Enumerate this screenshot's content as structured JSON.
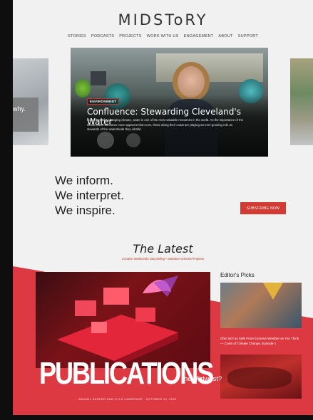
{
  "site": {
    "logo": "MIDSToRY",
    "nav": [
      "STORIES",
      "PODCASTS",
      "PROJECTS",
      "WORK WITH US",
      "ENGAGEMENT",
      "ABOUT",
      "SUPPORT"
    ]
  },
  "carousel": {
    "left_card_text": "why.",
    "hero": {
      "tag": "ENVIRONMENT",
      "title": "Confluence: Stewarding Cleveland's Water",
      "excerpt": "In the face of a changing climate, water is one of the most valuable resources in the world. As the importance of the Great Lakes becomes more apparent than ever, those along their coast are playing an ever-growing role as stewards of the watersheds they inhabit."
    }
  },
  "tagline": {
    "line1": "We inform.",
    "line2": "We interpret.",
    "line3": "We inspire."
  },
  "subscribe_label": "SUBSCRIBE NOW",
  "latest": {
    "title": "The Latest",
    "subtitle": "Creative Multimedia Storytelling • Solutions-oriented Projects"
  },
  "feature": {
    "title_tail": "he Midwest?",
    "byline": "ABIGAIL BARKER AND KYLE LAWRENCE  ·  OCTOBER 10, 2023"
  },
  "editors_picks": {
    "title": "Editor's Picks",
    "pick1_text": "Ohio isn't as Safe From Extreme Weather as You Think — Costs of Climate Change, Episode 1"
  },
  "overlay_word": "PUBLICATIONS",
  "colors": {
    "accent_red": "#d23b34",
    "band_red": "#d81f2a"
  }
}
